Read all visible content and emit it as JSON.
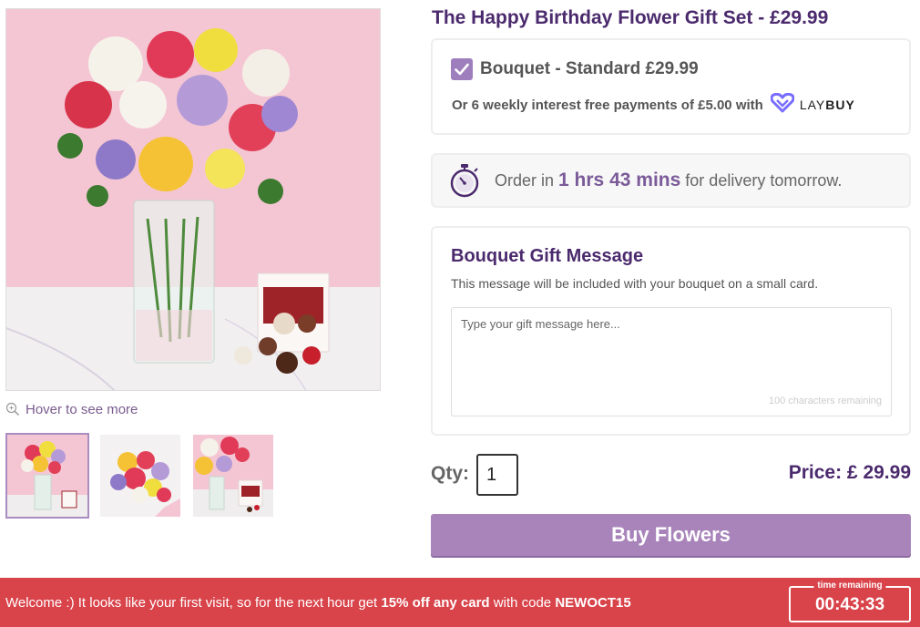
{
  "product": {
    "title": "The Happy Birthday Flower Gift Set - £29.99"
  },
  "gallery": {
    "hover_hint": "Hover to see more",
    "thumbnails": [
      {
        "name": "thumb-vase-chocolates",
        "active": true
      },
      {
        "name": "thumb-bouquet-topdown",
        "active": false
      },
      {
        "name": "thumb-bouquet-closeup",
        "active": false
      }
    ]
  },
  "option": {
    "label": "Bouquet - Standard £29.99",
    "checked": true
  },
  "laybuy": {
    "text": "Or 6 weekly interest free payments of £5.00 with",
    "logo_light": "LAY",
    "logo_bold": "BUY"
  },
  "delivery": {
    "prefix": "Order in",
    "time": "1 hrs 43 mins",
    "suffix": "for delivery tomorrow."
  },
  "gift_message": {
    "title": "Bouquet Gift Message",
    "subtitle": "This message will be included with your bouquet on a small card.",
    "placeholder": "Type your gift message here...",
    "char_count": "100 characters remaining"
  },
  "purchase": {
    "qty_label": "Qty:",
    "qty_value": "1",
    "price": "Price: £ 29.99",
    "buy_label": "Buy Flowers"
  },
  "promo": {
    "text_1": "Welcome :) It looks like your first visit, so for the next hour get ",
    "text_bold_1": "15% off any card",
    "text_2": " with code ",
    "text_bold_2": "NEWOCT15",
    "timer_label": "time remaining",
    "timer_value": "00:43:33"
  },
  "colors": {
    "brand_purple": "#4b2a6d",
    "button_purple": "#a884bb",
    "promo_red": "#d9434a"
  }
}
